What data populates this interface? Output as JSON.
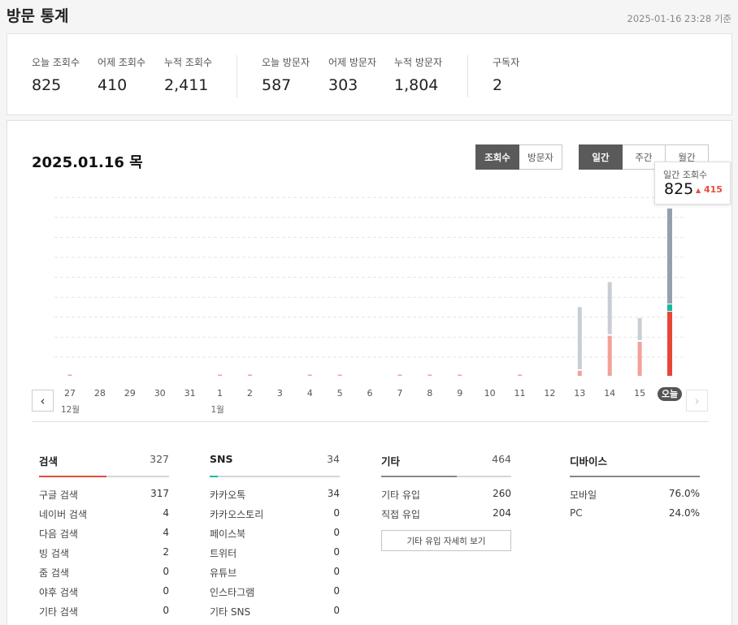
{
  "page": {
    "title": "방문 통계",
    "basis": "2025-01-16 23:28 기준"
  },
  "summary": {
    "views": [
      {
        "label": "오늘 조회수",
        "value": "825"
      },
      {
        "label": "어제 조회수",
        "value": "410"
      },
      {
        "label": "누적 조회수",
        "value": "2,411"
      }
    ],
    "visitors": [
      {
        "label": "오늘 방문자",
        "value": "587"
      },
      {
        "label": "어제 방문자",
        "value": "303"
      },
      {
        "label": "누적 방문자",
        "value": "1,804"
      }
    ],
    "subscribers": {
      "label": "구독자",
      "value": "2"
    }
  },
  "chart_header": {
    "date": "2025.01.16 목",
    "metric_tabs": [
      {
        "label": "조회수",
        "selected": true
      },
      {
        "label": "방문자",
        "selected": false
      }
    ],
    "period_tabs": [
      {
        "label": "일간",
        "selected": true
      },
      {
        "label": "주간",
        "selected": false
      },
      {
        "label": "월간",
        "selected": false
      }
    ],
    "tooltip": {
      "label": "일간 조회수",
      "value": "825",
      "diff": "415",
      "diff_icon": "triangle-up-icon"
    }
  },
  "colors": {
    "gray_stack": "#a9b0b9",
    "red_stack": "#f2a197",
    "today_gray": "#95a0ad",
    "today_red": "#e8453a",
    "today_teal": "#19b8a0",
    "search_accent": "#e74c3c",
    "sns_accent": "#1abc9c",
    "other_accent": "#888888",
    "device_accent": "#888888"
  },
  "chart_data": {
    "type": "bar",
    "stacked": true,
    "categories": [
      "27",
      "28",
      "29",
      "30",
      "31",
      "1",
      "2",
      "3",
      "4",
      "5",
      "6",
      "7",
      "8",
      "9",
      "10",
      "11",
      "12",
      "13",
      "14",
      "15",
      "오늘"
    ],
    "month_labels": [
      {
        "index": 0,
        "label": "12월"
      },
      {
        "index": 5,
        "label": "1월"
      }
    ],
    "series": [
      {
        "values": [
          1,
          0,
          0,
          0,
          0,
          1,
          1,
          0,
          1,
          1,
          0,
          1,
          1,
          1,
          0,
          1,
          0,
          25,
          200,
          170,
          320
        ]
      },
      {
        "values": [
          0,
          0,
          0,
          0,
          0,
          0,
          0,
          0,
          0,
          0,
          0,
          0,
          0,
          0,
          0,
          0,
          0,
          310,
          260,
          110,
          475
        ]
      }
    ],
    "today_extra": 30,
    "ylim": [
      0,
      900
    ],
    "grid": true
  },
  "breakdown": {
    "search": {
      "title": "검색",
      "count": "327",
      "fill": 0.52,
      "rows": [
        {
          "label": "구글 검색",
          "value": "317"
        },
        {
          "label": "네이버 검색",
          "value": "4"
        },
        {
          "label": "다음 검색",
          "value": "4"
        },
        {
          "label": "빙 검색",
          "value": "2"
        },
        {
          "label": "줌 검색",
          "value": "0"
        },
        {
          "label": "야후 검색",
          "value": "0"
        },
        {
          "label": "기타 검색",
          "value": "0"
        }
      ]
    },
    "sns": {
      "title": "SNS",
      "count": "34",
      "fill": 0.06,
      "rows": [
        {
          "label": "카카오톡",
          "value": "34"
        },
        {
          "label": "카카오스토리",
          "value": "0"
        },
        {
          "label": "페이스북",
          "value": "0"
        },
        {
          "label": "트위터",
          "value": "0"
        },
        {
          "label": "유튜브",
          "value": "0"
        },
        {
          "label": "인스타그램",
          "value": "0"
        },
        {
          "label": "기타 SNS",
          "value": "0"
        }
      ]
    },
    "other": {
      "title": "기타",
      "count": "464",
      "fill": 0.58,
      "rows": [
        {
          "label": "기타 유입",
          "value": "260"
        },
        {
          "label": "직접 유입",
          "value": "204"
        }
      ],
      "detail_button": "기타 유입 자세히 보기"
    },
    "device": {
      "title": "디바이스",
      "fill": 1.0,
      "rows": [
        {
          "label": "모바일",
          "value": "76.0%"
        },
        {
          "label": "PC",
          "value": "24.0%"
        }
      ]
    }
  }
}
